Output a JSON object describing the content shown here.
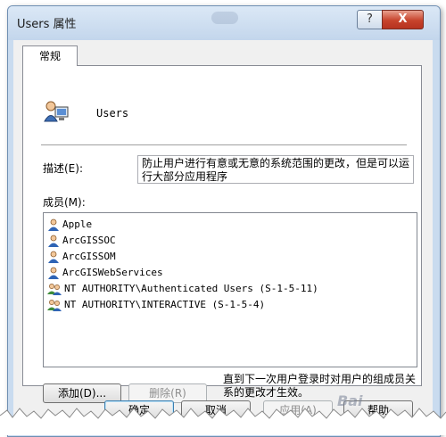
{
  "window": {
    "title": "Users 属性",
    "help_glyph": "?",
    "close_glyph": "X"
  },
  "tabs": [
    {
      "label": "常规"
    }
  ],
  "group": {
    "name": "Users",
    "icon": "group-icon"
  },
  "description": {
    "label": "描述(E):",
    "value": "防止用户进行有意或无意的系统范围的更改，但是可以运行大部分应用程序"
  },
  "members": {
    "label": "成员(M):",
    "items": [
      {
        "name": "Apple",
        "icon": "user-icon"
      },
      {
        "name": "ArcGISSOC",
        "icon": "user-icon"
      },
      {
        "name": "ArcGISSOM",
        "icon": "user-icon"
      },
      {
        "name": "ArcGISWebServices",
        "icon": "user-icon"
      },
      {
        "name": "NT AUTHORITY\\Authenticated Users (S-1-5-11)",
        "icon": "group-icon"
      },
      {
        "name": "NT AUTHORITY\\INTERACTIVE (S-1-5-4)",
        "icon": "group-icon"
      }
    ]
  },
  "actions": {
    "add_label": "添加(D)...",
    "remove_label": "删除(R)",
    "note": "直到下一次用户登录时对用户的组成员关系的更改才生效。"
  },
  "footer": {
    "ok_label": "确定",
    "cancel_label": "取消",
    "apply_label": "应用(A)",
    "help_label": "帮助"
  },
  "watermark": "Bai"
}
